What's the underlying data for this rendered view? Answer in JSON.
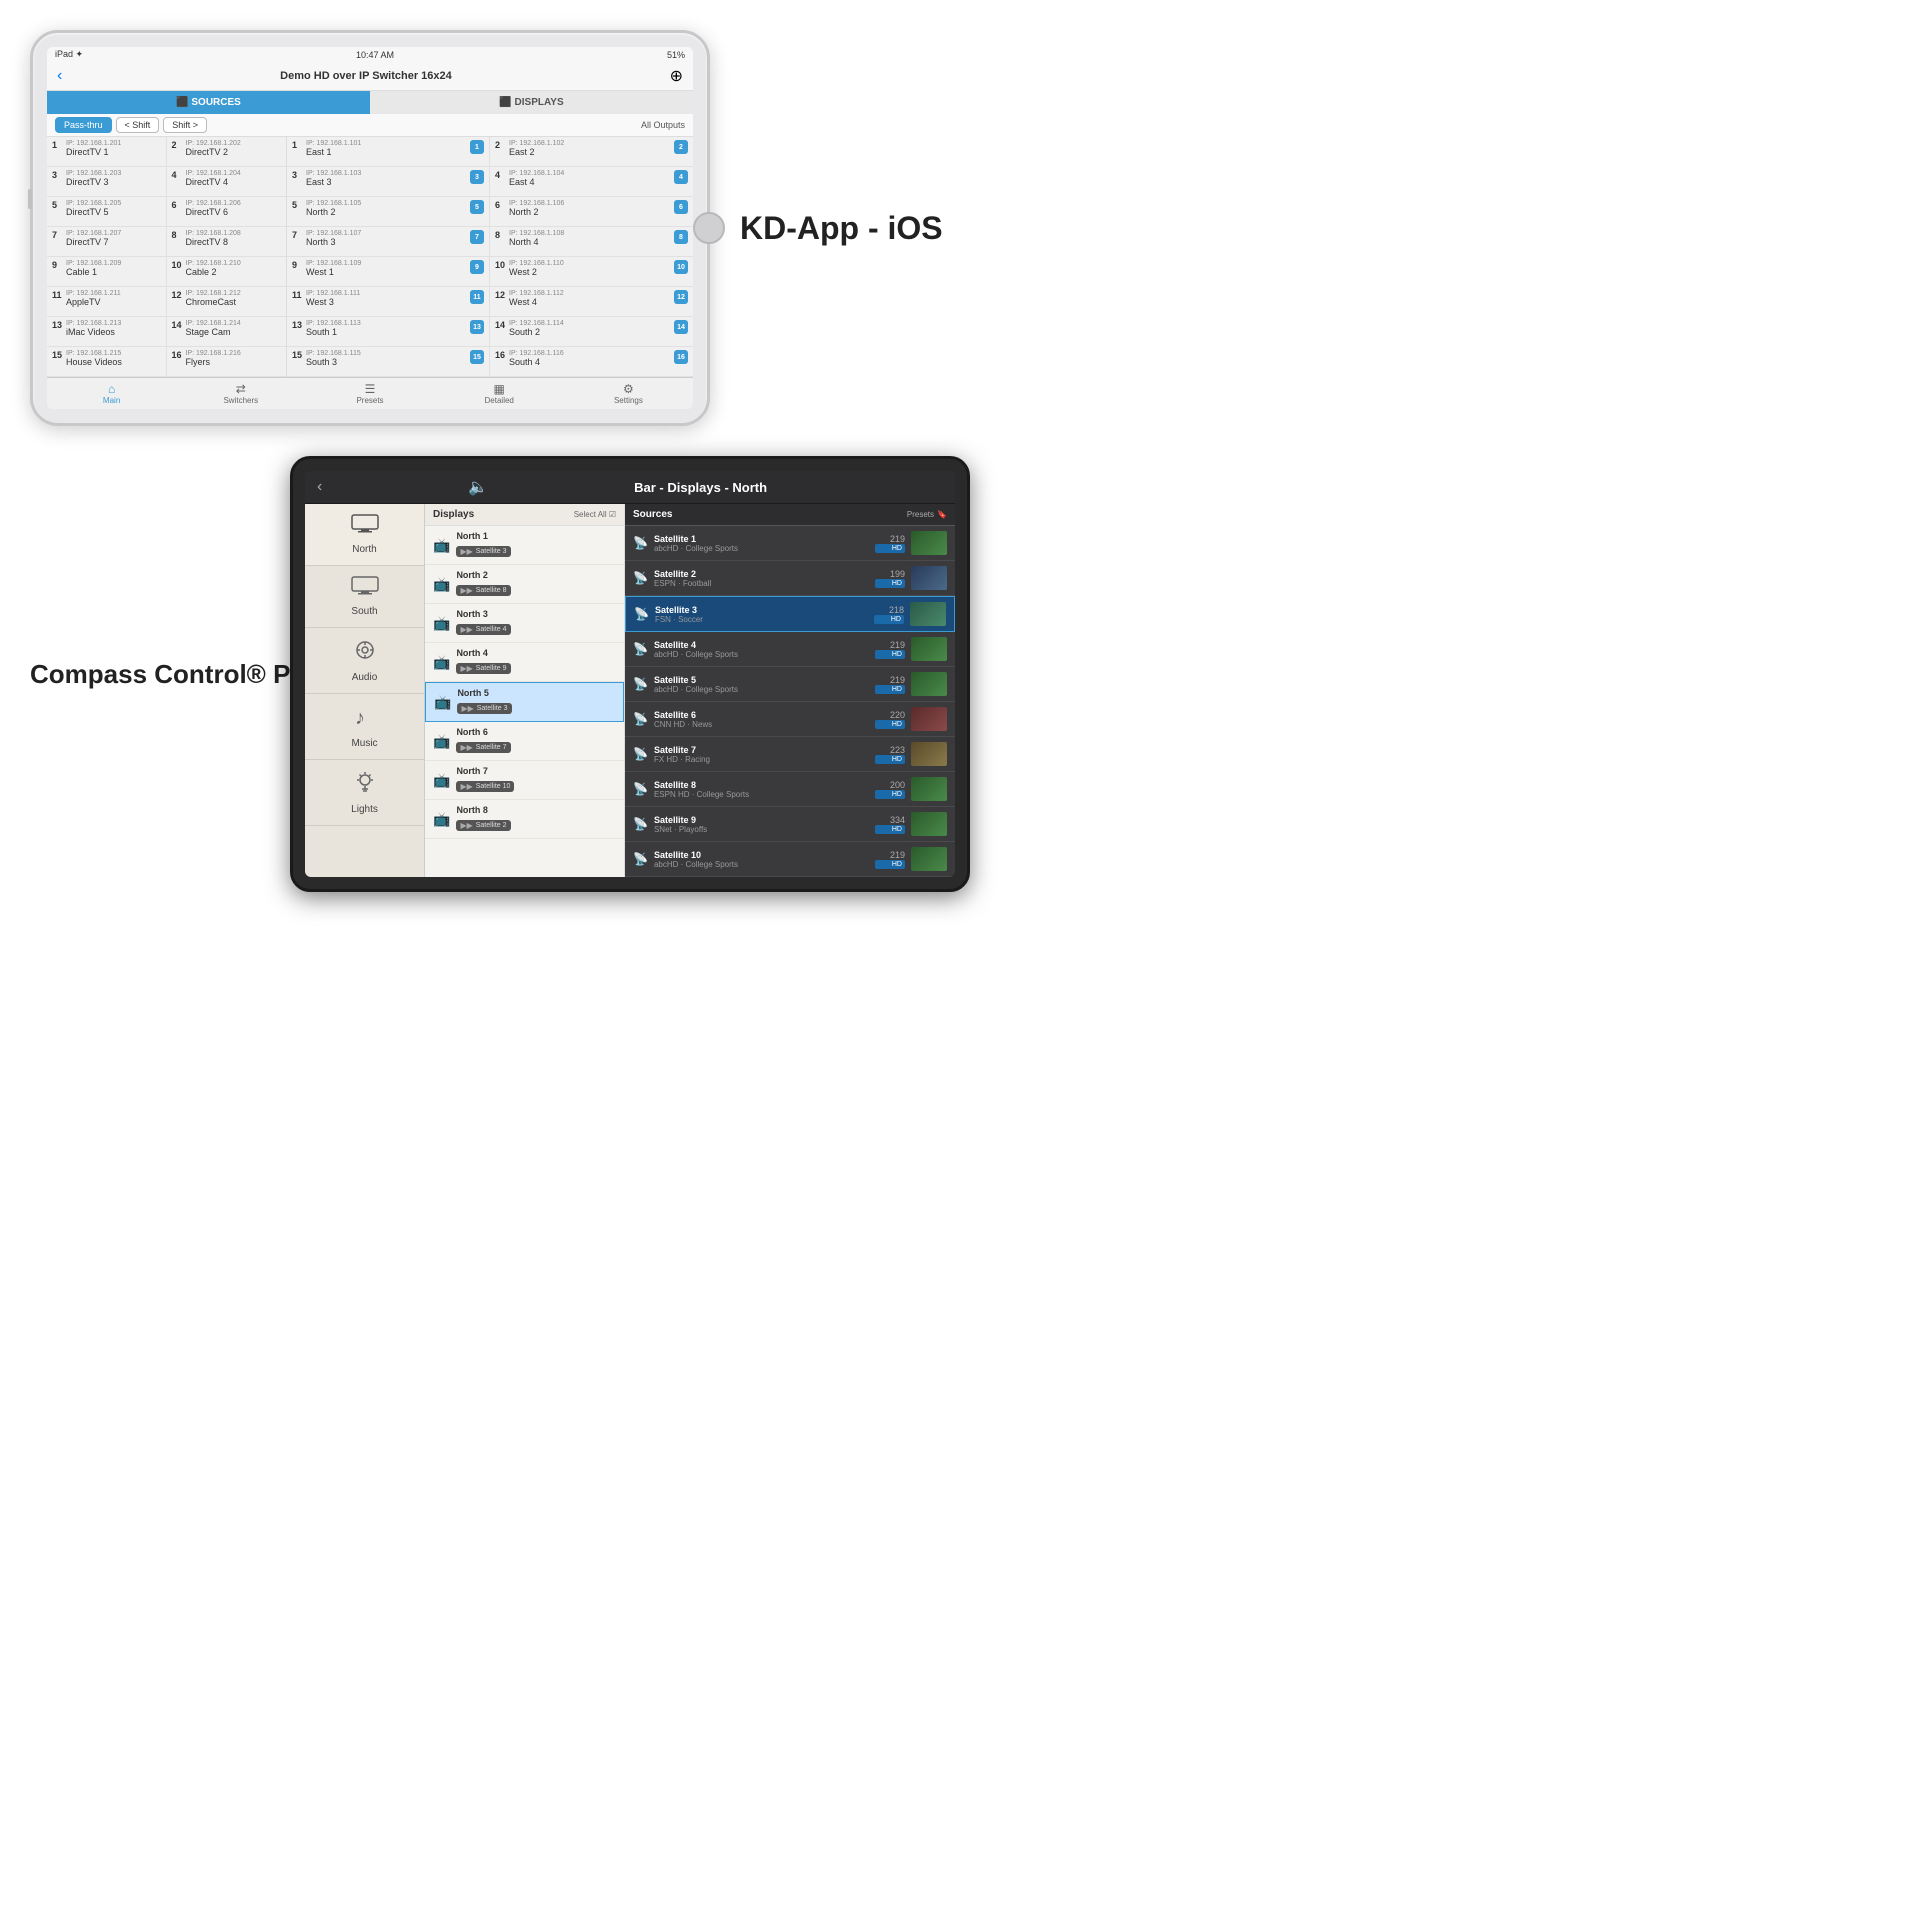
{
  "top": {
    "app_title": "KD-App - iOS",
    "ipad": {
      "status_bar": {
        "left": "iPad ✦",
        "center": "10:47 AM",
        "right": "51%"
      },
      "nav_title": "Demo HD over IP Switcher 16x24",
      "tabs": [
        {
          "label": "⬛ SOURCES",
          "active": true
        },
        {
          "label": "⬛ DISPLAYS",
          "active": false
        }
      ],
      "sub_controls": {
        "passthru": "Pass-thru",
        "shift_left": "< Shift",
        "shift_right": "Shift >",
        "all_outputs": "All Outputs"
      },
      "sources": [
        {
          "num": "1",
          "ip": "IP: 192.168.1.201",
          "name": "DirectTV 1"
        },
        {
          "num": "2",
          "ip": "IP: 192.168.1.202",
          "name": "DirectTV 2"
        },
        {
          "num": "3",
          "ip": "IP: 192.168.1.203",
          "name": "DirectTV 3"
        },
        {
          "num": "4",
          "ip": "IP: 192.168.1.204",
          "name": "DirectTV 4"
        },
        {
          "num": "5",
          "ip": "IP: 192.168.1.205",
          "name": "DirectTV 5"
        },
        {
          "num": "6",
          "ip": "IP: 192.168.1.206",
          "name": "DirectTV 6"
        },
        {
          "num": "7",
          "ip": "IP: 192.168.1.207",
          "name": "DirectTV 7"
        },
        {
          "num": "8",
          "ip": "IP: 192.168.1.208",
          "name": "DirectTV 8"
        },
        {
          "num": "9",
          "ip": "IP: 192.168.1.209",
          "name": "Cable 1"
        },
        {
          "num": "10",
          "ip": "IP: 192.168.1.210",
          "name": "Cable 2"
        },
        {
          "num": "11",
          "ip": "IP: 192.168.1.211",
          "name": "AppleTV"
        },
        {
          "num": "12",
          "ip": "IP: 192.168.1.212",
          "name": "ChromeCast"
        },
        {
          "num": "13",
          "ip": "IP: 192.168.1.213",
          "name": "iMac Videos"
        },
        {
          "num": "14",
          "ip": "IP: 192.168.1.214",
          "name": "Stage Cam"
        },
        {
          "num": "15",
          "ip": "IP: 192.168.1.215",
          "name": "House Videos"
        },
        {
          "num": "16",
          "ip": "IP: 192.168.1.216",
          "name": "Flyers"
        }
      ],
      "displays": [
        {
          "num": "1",
          "ip": "IP: 192.168.1.101",
          "name": "East 1",
          "badge": "1"
        },
        {
          "num": "2",
          "ip": "IP: 192.168.1.102",
          "name": "East 2",
          "badge": "2"
        },
        {
          "num": "3",
          "ip": "IP: 192.168.1.103",
          "name": "East 3",
          "badge": "3"
        },
        {
          "num": "4",
          "ip": "IP: 192.168.1.104",
          "name": "East 4",
          "badge": "4"
        },
        {
          "num": "5",
          "ip": "IP: 192.168.1.105",
          "name": "North 2",
          "badge": "5"
        },
        {
          "num": "6",
          "ip": "IP: 192.168.1.106",
          "name": "North 2",
          "badge": "6"
        },
        {
          "num": "7",
          "ip": "IP: 192.168.1.107",
          "name": "North 3",
          "badge": "7"
        },
        {
          "num": "8",
          "ip": "IP: 192.168.1.108",
          "name": "North 4",
          "badge": "8"
        },
        {
          "num": "9",
          "ip": "IP: 192.168.1.109",
          "name": "West 1",
          "badge": "9"
        },
        {
          "num": "10",
          "ip": "IP: 192.168.1.110",
          "name": "West 2",
          "badge": "10"
        },
        {
          "num": "11",
          "ip": "IP: 192.168.1.111",
          "name": "West 3",
          "badge": "11"
        },
        {
          "num": "12",
          "ip": "IP: 192.168.1.112",
          "name": "West 4",
          "badge": "12"
        },
        {
          "num": "13",
          "ip": "IP: 192.168.1.113",
          "name": "South 1",
          "badge": "13"
        },
        {
          "num": "14",
          "ip": "IP: 192.168.1.114",
          "name": "South 2",
          "badge": "14"
        },
        {
          "num": "15",
          "ip": "IP: 192.168.1.115",
          "name": "South 3",
          "badge": "15"
        },
        {
          "num": "16",
          "ip": "IP: 192.168.1.116",
          "name": "South 4",
          "badge": "16"
        }
      ],
      "bottom_tabs": [
        {
          "icon": "⌂",
          "label": "Main"
        },
        {
          "icon": "⇄",
          "label": "Switchers"
        },
        {
          "icon": "☰",
          "label": "Presets"
        },
        {
          "icon": "▦",
          "label": "Detailed"
        },
        {
          "icon": "⚙",
          "label": "Settings"
        }
      ]
    }
  },
  "bottom": {
    "app_title": "Compass Control® Pro",
    "tablet": {
      "nav_title": "Bar - Displays - North",
      "categories": [
        {
          "icon": "🖥",
          "label": "North",
          "active": true
        },
        {
          "icon": "🖥",
          "label": "South"
        },
        {
          "icon": "🔊",
          "label": "Audio"
        },
        {
          "icon": "♪",
          "label": "Music"
        },
        {
          "icon": "💡",
          "label": "Lights"
        }
      ],
      "displays_panel": {
        "title": "Displays",
        "select_all": "Select All",
        "items": [
          {
            "name": "North 1",
            "source": "Satellite 3"
          },
          {
            "name": "North 2",
            "source": "Satellite 8"
          },
          {
            "name": "North 3",
            "source": "Satellite 4"
          },
          {
            "name": "North 4",
            "source": "Satellite 9"
          },
          {
            "name": "North 5",
            "source": "Satellite 3",
            "selected": true
          },
          {
            "name": "North 6",
            "source": "Satellite 7"
          },
          {
            "name": "North 7",
            "source": "Satellite 10"
          },
          {
            "name": "North 8",
            "source": "Satellite 2"
          }
        ]
      },
      "sources_panel": {
        "title": "Sources",
        "presets": "Presets",
        "items": [
          {
            "name": "Satellite 1",
            "channel": "abcHD",
            "sub": "College Sports",
            "num": "219",
            "badge": "HD",
            "thumb_type": "sports"
          },
          {
            "name": "Satellite 2",
            "channel": "ESPN",
            "sub": "Football",
            "num": "199",
            "badge": "HD",
            "thumb_type": "football"
          },
          {
            "name": "Satellite 3",
            "channel": "FSN",
            "sub": "Soccer",
            "num": "218",
            "badge": "HD",
            "thumb_type": "soccer",
            "selected": true
          },
          {
            "name": "Satellite 4",
            "channel": "abcHD",
            "sub": "College Sports",
            "num": "219",
            "badge": "HD",
            "thumb_type": "sports"
          },
          {
            "name": "Satellite 5",
            "channel": "abcHD",
            "sub": "College Sports",
            "num": "219",
            "badge": "HD",
            "thumb_type": "sports"
          },
          {
            "name": "Satellite 6",
            "channel": "CNN HD",
            "sub": "News",
            "num": "220",
            "badge": "HD",
            "thumb_type": "news"
          },
          {
            "name": "Satellite 7",
            "channel": "FX HD",
            "sub": "Racing",
            "num": "223",
            "badge": "HD",
            "thumb_type": "racing"
          },
          {
            "name": "Satellite 8",
            "channel": "ESPN HD",
            "sub": "College Sports",
            "num": "200",
            "badge": "HD",
            "thumb_type": "sports"
          },
          {
            "name": "Satellite 9",
            "channel": "SNet",
            "sub": "Playoffs",
            "num": "334",
            "badge": "HD",
            "thumb_type": "sports"
          },
          {
            "name": "Satellite 10",
            "channel": "abcHD",
            "sub": "College Sports",
            "num": "219",
            "badge": "HD",
            "thumb_type": "sports"
          }
        ]
      }
    }
  }
}
